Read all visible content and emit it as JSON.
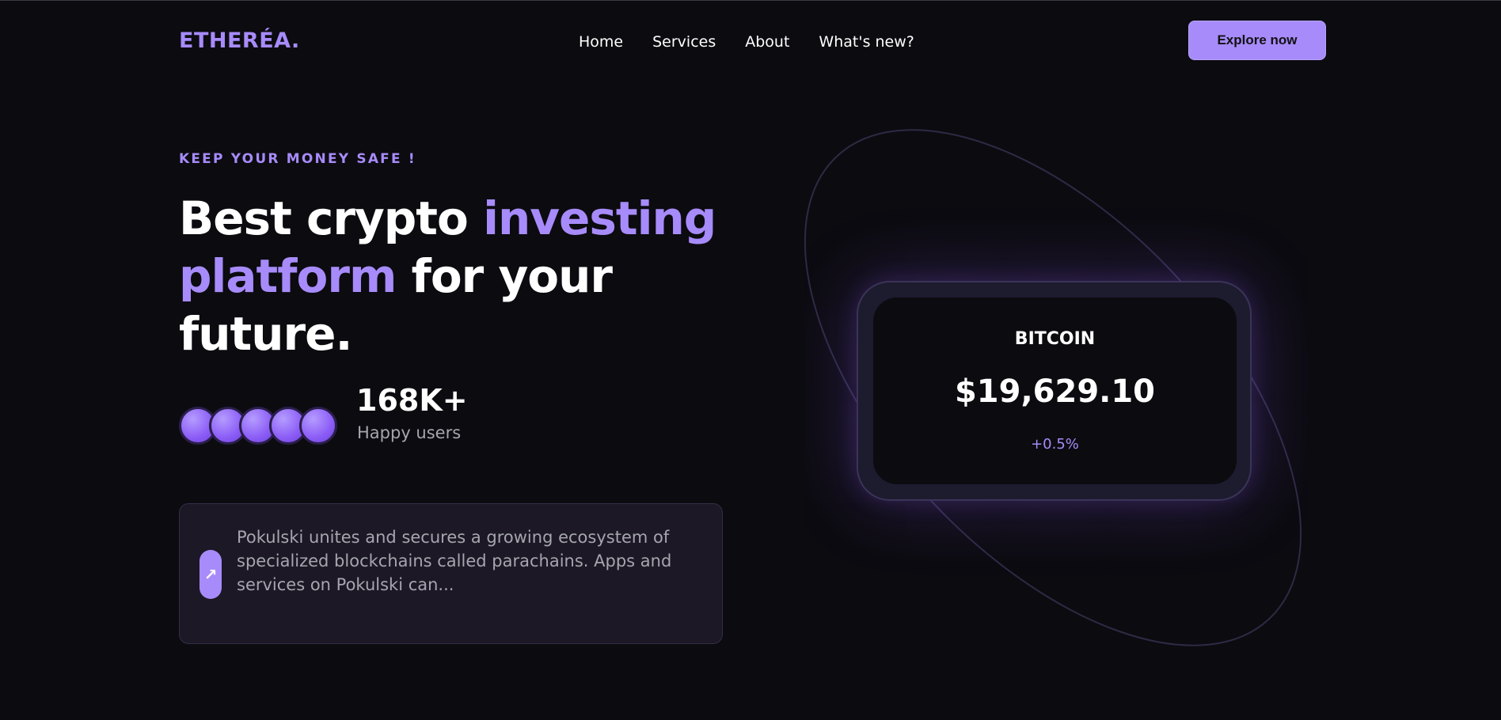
{
  "brand": {
    "name": "ETHERÉA.",
    "accent_color": "#a78bfa"
  },
  "nav": {
    "items": [
      "Home",
      "Services",
      "About",
      "What's new?"
    ]
  },
  "header": {
    "cta_label": "Explore now"
  },
  "hero": {
    "eyebrow": "KEEP YOUR MONEY SAFE !",
    "headline_part1": "Best crypto ",
    "headline_accent": "investing platform",
    "headline_part2": " for your future."
  },
  "stats": {
    "value": "168K+",
    "label": "Happy users",
    "avatar_count": 5
  },
  "info_card": {
    "icon": "arrow-up-right-icon",
    "text": "Pokulski unites and secures a growing ecosystem of specialized blockchains called parachains. Apps and services on Pokulski can..."
  },
  "ticker": {
    "name": "BITCOIN",
    "price": "$19,629.10",
    "change": "+0.5%"
  }
}
